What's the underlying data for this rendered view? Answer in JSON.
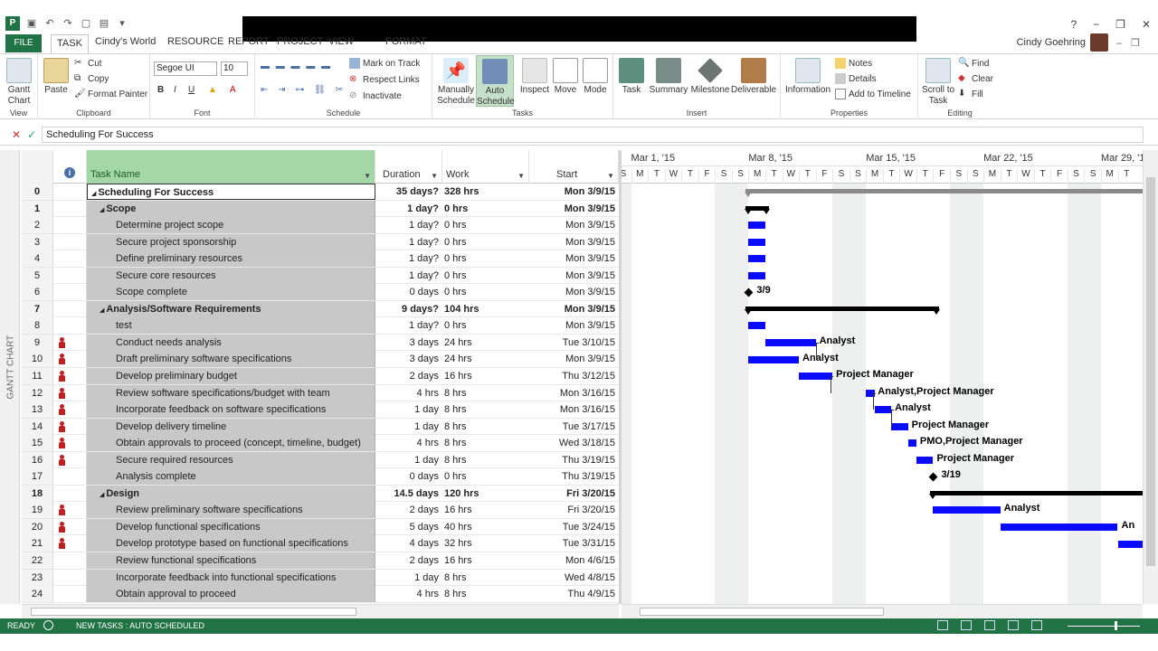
{
  "title_bar": {
    "user_name": "Cindy Goehring",
    "help": "?",
    "minimize": "−",
    "restore": "❐",
    "close": "✕"
  },
  "tabs": [
    {
      "label": "FILE",
      "id": "file"
    },
    {
      "label": "TASK",
      "id": "task"
    },
    {
      "label": "Cindy's World",
      "id": "cindys-world"
    },
    {
      "label": "RESOURCE",
      "id": "resource"
    },
    {
      "label": "REPORT",
      "id": "report"
    },
    {
      "label": "PROJECT",
      "id": "project"
    },
    {
      "label": "VIEW",
      "id": "view"
    },
    {
      "label": "FORMAT",
      "id": "format"
    }
  ],
  "ribbon": {
    "view": {
      "label": "View",
      "gantt": "Gantt Chart"
    },
    "clipboard": {
      "label": "Clipboard",
      "paste": "Paste",
      "cut": "Cut",
      "copy": "Copy",
      "format_painter": "Format Painter"
    },
    "font": {
      "label": "Font",
      "font_name": "Segoe UI",
      "font_size": "10",
      "bold": "B",
      "italic": "I",
      "underline": "U"
    },
    "schedule": {
      "label": "Schedule",
      "mark_on_track": "Mark on Track",
      "respect_links": "Respect Links",
      "inactivate": "Inactivate"
    },
    "tasks": {
      "label": "Tasks",
      "manual": "Manually Schedule",
      "auto": "Auto Schedule",
      "inspect": "Inspect",
      "move": "Move",
      "mode": "Mode"
    },
    "insert": {
      "label": "Insert",
      "task": "Task",
      "summary": "Summary",
      "milestone": "Milestone",
      "deliverable": "Deliverable"
    },
    "properties": {
      "label": "Properties",
      "information": "Information",
      "notes": "Notes",
      "details": "Details",
      "add_to_timeline": "Add to Timeline"
    },
    "editing": {
      "label": "Editing",
      "scroll": "Scroll to Task",
      "find": "Find",
      "clear": "Clear",
      "fill": "Fill"
    }
  },
  "entry_bar": {
    "value": "Scheduling For Success"
  },
  "view_label": "GANTT CHART",
  "grid": {
    "columns": {
      "task_name": "Task Name",
      "duration": "Duration",
      "work": "Work",
      "start": "Start",
      "info": "i"
    },
    "rows": [
      {
        "id": "0",
        "name": "Scheduling For Success",
        "duration": "35 days?",
        "work": "328 hrs",
        "start": "Mon 3/9/15",
        "level": 0,
        "summary": true,
        "res": false
      },
      {
        "id": "1",
        "name": "Scope",
        "duration": "1 day?",
        "work": "0 hrs",
        "start": "Mon 3/9/15",
        "level": 1,
        "summary": true,
        "res": false
      },
      {
        "id": "2",
        "name": "Determine project scope",
        "duration": "1 day?",
        "work": "0 hrs",
        "start": "Mon 3/9/15",
        "level": 2,
        "summary": false,
        "res": false
      },
      {
        "id": "3",
        "name": "Secure project sponsorship",
        "duration": "1 day?",
        "work": "0 hrs",
        "start": "Mon 3/9/15",
        "level": 2,
        "summary": false,
        "res": false
      },
      {
        "id": "4",
        "name": "Define preliminary resources",
        "duration": "1 day?",
        "work": "0 hrs",
        "start": "Mon 3/9/15",
        "level": 2,
        "summary": false,
        "res": false
      },
      {
        "id": "5",
        "name": "Secure core resources",
        "duration": "1 day?",
        "work": "0 hrs",
        "start": "Mon 3/9/15",
        "level": 2,
        "summary": false,
        "res": false
      },
      {
        "id": "6",
        "name": "Scope complete",
        "duration": "0 days",
        "work": "0 hrs",
        "start": "Mon 3/9/15",
        "level": 2,
        "summary": false,
        "res": false
      },
      {
        "id": "7",
        "name": "Analysis/Software Requirements",
        "duration": "9 days?",
        "work": "104 hrs",
        "start": "Mon 3/9/15",
        "level": 1,
        "summary": true,
        "res": false
      },
      {
        "id": "8",
        "name": "test",
        "duration": "1 day?",
        "work": "0 hrs",
        "start": "Mon 3/9/15",
        "level": 2,
        "summary": false,
        "res": false
      },
      {
        "id": "9",
        "name": "Conduct needs analysis",
        "duration": "3 days",
        "work": "24 hrs",
        "start": "Tue 3/10/15",
        "level": 2,
        "summary": false,
        "res": true
      },
      {
        "id": "10",
        "name": "Draft preliminary software specifications",
        "duration": "3 days",
        "work": "24 hrs",
        "start": "Mon 3/9/15",
        "level": 2,
        "summary": false,
        "res": true
      },
      {
        "id": "11",
        "name": "Develop preliminary budget",
        "duration": "2 days",
        "work": "16 hrs",
        "start": "Thu 3/12/15",
        "level": 2,
        "summary": false,
        "res": true
      },
      {
        "id": "12",
        "name": "Review software specifications/budget with team",
        "duration": "4 hrs",
        "work": "8 hrs",
        "start": "Mon 3/16/15",
        "level": 2,
        "summary": false,
        "res": true
      },
      {
        "id": "13",
        "name": "Incorporate feedback on software specifications",
        "duration": "1 day",
        "work": "8 hrs",
        "start": "Mon 3/16/15",
        "level": 2,
        "summary": false,
        "res": true
      },
      {
        "id": "14",
        "name": "Develop delivery timeline",
        "duration": "1 day",
        "work": "8 hrs",
        "start": "Tue 3/17/15",
        "level": 2,
        "summary": false,
        "res": true
      },
      {
        "id": "15",
        "name": "Obtain approvals to proceed (concept, timeline, budget)",
        "duration": "4 hrs",
        "work": "8 hrs",
        "start": "Wed 3/18/15",
        "level": 2,
        "summary": false,
        "res": true
      },
      {
        "id": "16",
        "name": "Secure required resources",
        "duration": "1 day",
        "work": "8 hrs",
        "start": "Thu 3/19/15",
        "level": 2,
        "summary": false,
        "res": true
      },
      {
        "id": "17",
        "name": "Analysis complete",
        "duration": "0 days",
        "work": "0 hrs",
        "start": "Thu 3/19/15",
        "level": 2,
        "summary": false,
        "res": false
      },
      {
        "id": "18",
        "name": "Design",
        "duration": "14.5 days",
        "work": "120 hrs",
        "start": "Fri 3/20/15",
        "level": 1,
        "summary": true,
        "res": false
      },
      {
        "id": "19",
        "name": "Review preliminary software specifications",
        "duration": "2 days",
        "work": "16 hrs",
        "start": "Fri 3/20/15",
        "level": 2,
        "summary": false,
        "res": true
      },
      {
        "id": "20",
        "name": "Develop functional specifications",
        "duration": "5 days",
        "work": "40 hrs",
        "start": "Tue 3/24/15",
        "level": 2,
        "summary": false,
        "res": true
      },
      {
        "id": "21",
        "name": "Develop prototype based on functional specifications",
        "duration": "4 days",
        "work": "32 hrs",
        "start": "Tue 3/31/15",
        "level": 2,
        "summary": false,
        "res": true
      },
      {
        "id": "22",
        "name": "Review functional specifications",
        "duration": "2 days",
        "work": "16 hrs",
        "start": "Mon 4/6/15",
        "level": 2,
        "summary": false,
        "res": false
      },
      {
        "id": "23",
        "name": "Incorporate feedback into functional specifications",
        "duration": "1 day",
        "work": "8 hrs",
        "start": "Wed 4/8/15",
        "level": 2,
        "summary": false,
        "res": false
      },
      {
        "id": "24",
        "name": "Obtain approval to proceed",
        "duration": "4 hrs",
        "work": "8 hrs",
        "start": "Thu 4/9/15",
        "level": 2,
        "summary": false,
        "res": false
      }
    ]
  },
  "timescale": {
    "weeks": [
      "Mar 1, '15",
      "Mar 8, '15",
      "Mar 15, '15",
      "Mar 22, '15",
      "Mar 29, '15"
    ],
    "days": [
      "S",
      "M",
      "T",
      "W",
      "T",
      "F",
      "S",
      "S",
      "M",
      "T",
      "W",
      "T",
      "F",
      "S",
      "S",
      "M",
      "T",
      "W",
      "T",
      "F",
      "S",
      "S",
      "M",
      "T",
      "W",
      "T",
      "F",
      "S",
      "S",
      "M",
      "T"
    ]
  },
  "gantt_labels": {
    "ms6": "3/9",
    "r9": "Analyst",
    "r10": "Analyst",
    "r11": "Project Manager",
    "r12": "Analyst,Project Manager",
    "r13": "Analyst",
    "r14": "Project Manager",
    "r15": "PMO,Project Manager",
    "r16": "Project Manager",
    "ms17": "3/19",
    "r19": "Analyst",
    "r20": "An"
  },
  "status_bar": {
    "ready": "READY",
    "new_tasks": "NEW TASKS : AUTO SCHEDULED"
  },
  "colors": {
    "accent": "#217346",
    "task_bar": "#0a0aff",
    "resource_icon": "#c0201f"
  }
}
